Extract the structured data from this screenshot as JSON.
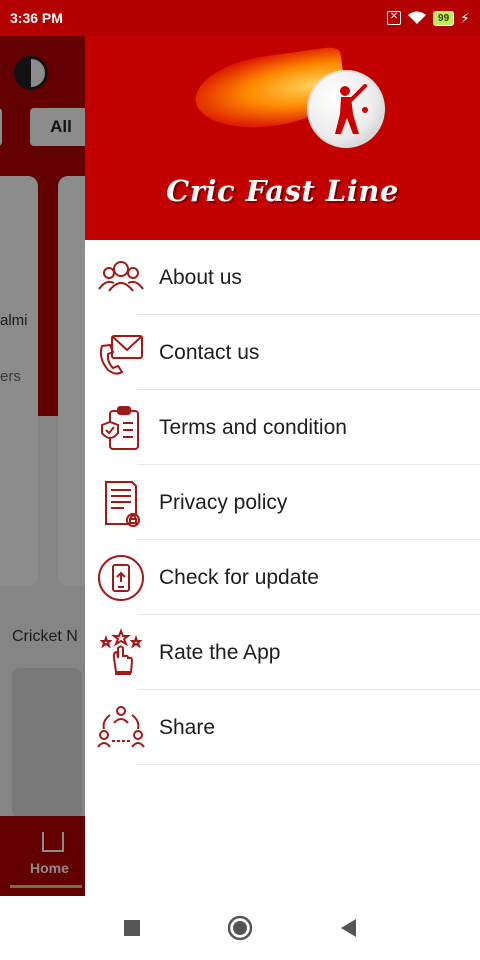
{
  "status_bar": {
    "time": "3:36 PM",
    "battery": "99"
  },
  "background_app": {
    "filter_chip": "All",
    "card_snippets": [
      "almi",
      "ers"
    ],
    "section_label": "Cricket N",
    "bottom_nav_label": "Home"
  },
  "drawer": {
    "brand": "Cric Fast Line",
    "items": [
      {
        "label": "About us",
        "icon": "users-icon"
      },
      {
        "label": "Contact us",
        "icon": "contact-icon"
      },
      {
        "label": "Terms and condition",
        "icon": "terms-icon"
      },
      {
        "label": "Privacy policy",
        "icon": "privacy-icon"
      },
      {
        "label": "Check for update",
        "icon": "update-icon"
      },
      {
        "label": "Rate the App",
        "icon": "rate-icon"
      },
      {
        "label": "Share",
        "icon": "share-icon"
      }
    ]
  },
  "colors": {
    "brand_red": "#c30000",
    "icon_red": "#a11a1a"
  }
}
